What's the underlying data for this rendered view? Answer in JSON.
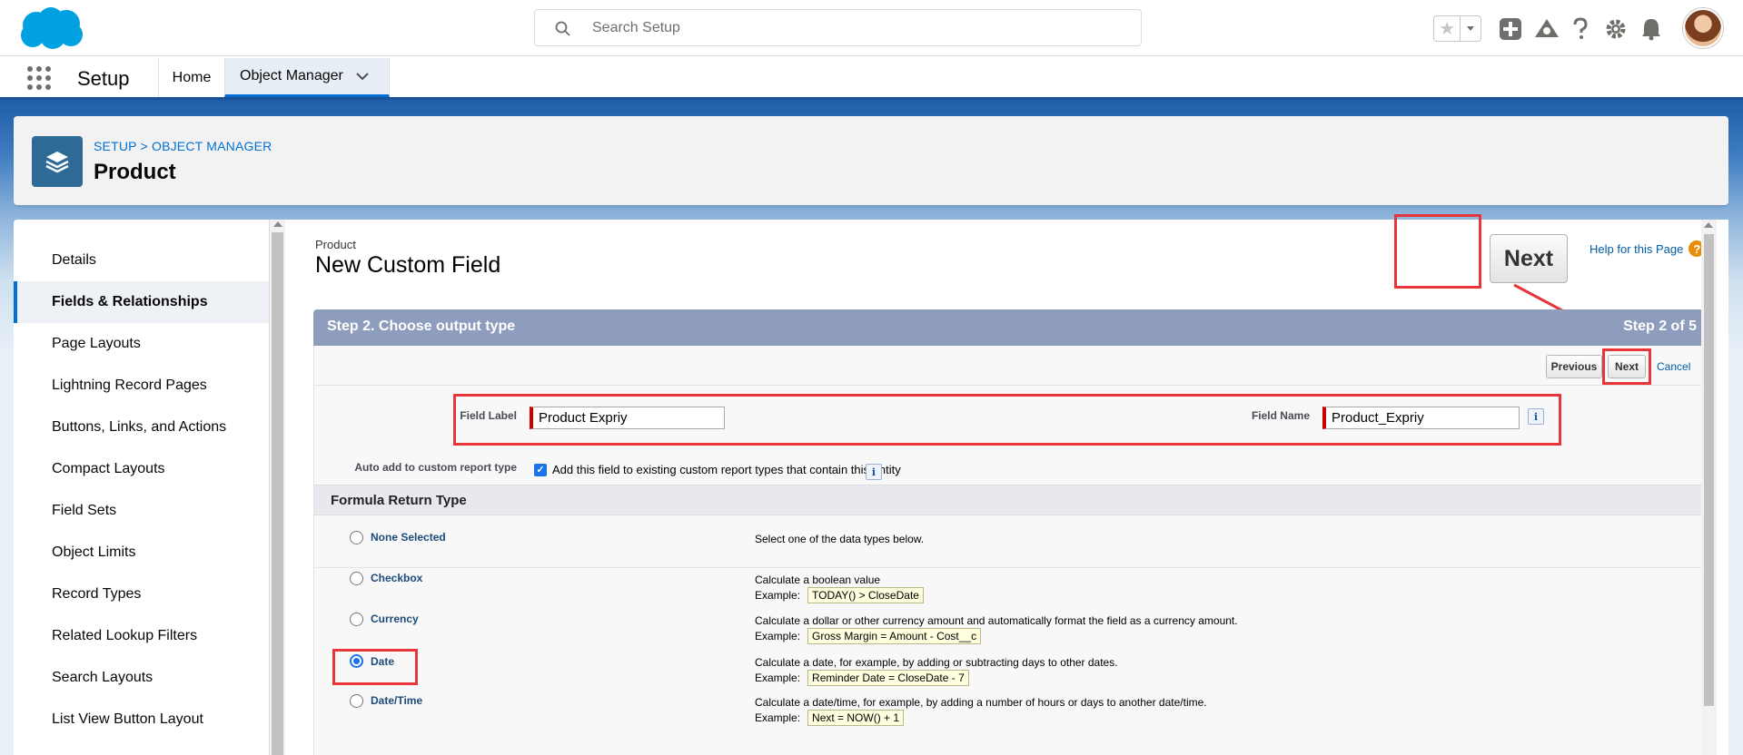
{
  "header": {
    "search_placeholder": "Search Setup"
  },
  "context_bar": {
    "app_name": "Setup",
    "tabs": [
      {
        "label": "Home"
      },
      {
        "label": "Object Manager"
      }
    ]
  },
  "object_header": {
    "breadcrumb": "SETUP > OBJECT MANAGER",
    "title": "Product"
  },
  "sidebar": {
    "items": [
      {
        "label": "Details"
      },
      {
        "label": "Fields & Relationships"
      },
      {
        "label": "Page Layouts"
      },
      {
        "label": "Lightning Record Pages"
      },
      {
        "label": "Buttons, Links, and Actions"
      },
      {
        "label": "Compact Layouts"
      },
      {
        "label": "Field Sets"
      },
      {
        "label": "Object Limits"
      },
      {
        "label": "Record Types"
      },
      {
        "label": "Related Lookup Filters"
      },
      {
        "label": "Search Layouts"
      },
      {
        "label": "List View Button Layout"
      }
    ],
    "active_index": 1
  },
  "page": {
    "object_label": "Product",
    "title": "New Custom Field",
    "help_link": "Help for this Page",
    "callout_next_label": "Next",
    "step_title": "Step 2. Choose output type",
    "step_counter": "Step 2 of 5",
    "buttons": {
      "previous": "Previous",
      "next": "Next",
      "cancel": "Cancel"
    },
    "field_label_label": "Field Label",
    "field_label_value": "Product Expriy",
    "field_name_label": "Field Name",
    "field_name_value": "Product_Expriy",
    "auto_add_label": "Auto add to custom report type",
    "auto_add_text": "Add this field to existing custom report types that contain this entity",
    "auto_add_checked": true,
    "section_title": "Formula Return Type",
    "example_label": "Example:",
    "return_types": [
      {
        "name": "None Selected",
        "desc": "Select one of the data types below.",
        "example": "",
        "selected": false
      },
      {
        "name": "Checkbox",
        "desc": "Calculate a boolean value",
        "example": "TODAY() > CloseDate",
        "selected": false
      },
      {
        "name": "Currency",
        "desc": "Calculate a dollar or other currency amount and automatically format the field as a currency amount.",
        "example": "Gross Margin = Amount - Cost__c",
        "selected": false
      },
      {
        "name": "Date",
        "desc": "Calculate a date, for example, by adding or subtracting days to other dates.",
        "example": "Reminder Date = CloseDate - 7",
        "selected": true
      },
      {
        "name": "Date/Time",
        "desc": "Calculate a date/time, for example, by adding a number of hours or days to another date/time.",
        "example": "Next = NOW() + 1",
        "selected": false
      }
    ]
  },
  "colors": {
    "brand_blue": "#00a1e0",
    "link_blue": "#015ba7",
    "callout_red": "#e8353c",
    "step_bar": "#8e9dbe"
  }
}
